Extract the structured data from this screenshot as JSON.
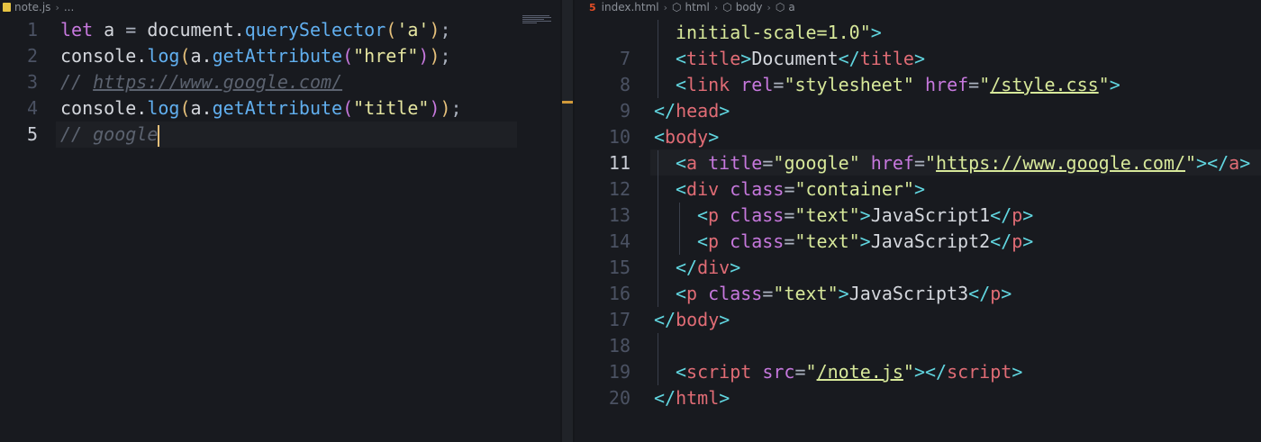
{
  "left_editor": {
    "breadcrumb": {
      "file": "note.js",
      "more": "..."
    },
    "lines": [
      {
        "num": "1",
        "tokens": [
          [
            "kw",
            "let"
          ],
          [
            "ident",
            " a "
          ],
          [
            "pun",
            "= "
          ],
          [
            "ident",
            "document."
          ],
          [
            "fn",
            "querySelector"
          ],
          [
            "paren",
            "("
          ],
          [
            "sq",
            "'a'"
          ],
          [
            "paren",
            ")"
          ],
          [
            "pun",
            ";"
          ]
        ]
      },
      {
        "num": "2",
        "tokens": [
          [
            "ident",
            "console."
          ],
          [
            "fn",
            "log"
          ],
          [
            "paren",
            "("
          ],
          [
            "ident",
            "a."
          ],
          [
            "fn",
            "getAttribute"
          ],
          [
            "paren2",
            "("
          ],
          [
            "str",
            "\"href\""
          ],
          [
            "paren2",
            ")"
          ],
          [
            "paren",
            ")"
          ],
          [
            "pun",
            ";"
          ]
        ]
      },
      {
        "num": "3",
        "tokens": [
          [
            "cmt",
            "// "
          ],
          [
            "cmt-u",
            "https://www.google.com/"
          ]
        ]
      },
      {
        "num": "4",
        "tokens": [
          [
            "ident",
            "console."
          ],
          [
            "fn",
            "log"
          ],
          [
            "paren",
            "("
          ],
          [
            "ident",
            "a."
          ],
          [
            "fn",
            "getAttribute"
          ],
          [
            "paren2",
            "("
          ],
          [
            "str",
            "\"title\""
          ],
          [
            "paren2",
            ")"
          ],
          [
            "paren",
            ")"
          ],
          [
            "pun",
            ";"
          ]
        ]
      },
      {
        "num": "5",
        "tokens": [
          [
            "cmt",
            "// google"
          ]
        ],
        "active": true,
        "cursor": true
      }
    ]
  },
  "right_editor": {
    "breadcrumb": {
      "file": "index.html",
      "items": [
        "html",
        "body",
        "a"
      ]
    },
    "lines": [
      {
        "num": "",
        "indent": 1,
        "tokens": [
          [
            "aval",
            "initial-scale=1.0\""
          ],
          [
            "brk",
            ">"
          ]
        ]
      },
      {
        "num": "7",
        "indent": 1,
        "tokens": [
          [
            "brk",
            "<"
          ],
          [
            "tag",
            "title"
          ],
          [
            "brk",
            ">"
          ],
          [
            "txt",
            "Document"
          ],
          [
            "brk",
            "</"
          ],
          [
            "tag",
            "title"
          ],
          [
            "brk",
            ">"
          ]
        ]
      },
      {
        "num": "8",
        "indent": 1,
        "tokens": [
          [
            "brk",
            "<"
          ],
          [
            "tag",
            "link "
          ],
          [
            "attr",
            "rel"
          ],
          [
            "pun",
            "="
          ],
          [
            "aval",
            "\"stylesheet\" "
          ],
          [
            "attr",
            "href"
          ],
          [
            "pun",
            "="
          ],
          [
            "aval",
            "\""
          ],
          [
            "url",
            "/style.css"
          ],
          [
            "aval",
            "\""
          ],
          [
            "brk",
            ">"
          ]
        ]
      },
      {
        "num": "9",
        "indent": 0,
        "tokens": [
          [
            "brk",
            "</"
          ],
          [
            "tag",
            "head"
          ],
          [
            "brk",
            ">"
          ]
        ]
      },
      {
        "num": "10",
        "indent": 0,
        "tokens": [
          [
            "brk",
            "<"
          ],
          [
            "tag",
            "body"
          ],
          [
            "brk",
            ">"
          ]
        ]
      },
      {
        "num": "11",
        "indent": 1,
        "active": true,
        "tokens": [
          [
            "brk",
            "<"
          ],
          [
            "tag",
            "a "
          ],
          [
            "attr",
            "title"
          ],
          [
            "pun",
            "="
          ],
          [
            "aval",
            "\"google\" "
          ],
          [
            "attr",
            "href"
          ],
          [
            "pun",
            "="
          ],
          [
            "aval",
            "\""
          ],
          [
            "url",
            "https://www.google.com/"
          ],
          [
            "aval",
            "\""
          ],
          [
            "brk",
            "></"
          ],
          [
            "tag",
            "a"
          ],
          [
            "brk",
            ">"
          ]
        ]
      },
      {
        "num": "12",
        "indent": 1,
        "tokens": [
          [
            "brk",
            "<"
          ],
          [
            "tag",
            "div "
          ],
          [
            "attr",
            "class"
          ],
          [
            "pun",
            "="
          ],
          [
            "aval",
            "\"container\""
          ],
          [
            "brk",
            ">"
          ]
        ]
      },
      {
        "num": "13",
        "indent": 2,
        "tokens": [
          [
            "brk",
            "<"
          ],
          [
            "tag",
            "p "
          ],
          [
            "attr",
            "class"
          ],
          [
            "pun",
            "="
          ],
          [
            "aval",
            "\"text\""
          ],
          [
            "brk",
            ">"
          ],
          [
            "txt",
            "JavaScript1"
          ],
          [
            "brk",
            "</"
          ],
          [
            "tag",
            "p"
          ],
          [
            "brk",
            ">"
          ]
        ]
      },
      {
        "num": "14",
        "indent": 2,
        "tokens": [
          [
            "brk",
            "<"
          ],
          [
            "tag",
            "p "
          ],
          [
            "attr",
            "class"
          ],
          [
            "pun",
            "="
          ],
          [
            "aval",
            "\"text\""
          ],
          [
            "brk",
            ">"
          ],
          [
            "txt",
            "JavaScript2"
          ],
          [
            "brk",
            "</"
          ],
          [
            "tag",
            "p"
          ],
          [
            "brk",
            ">"
          ]
        ]
      },
      {
        "num": "15",
        "indent": 1,
        "tokens": [
          [
            "brk",
            "</"
          ],
          [
            "tag",
            "div"
          ],
          [
            "brk",
            ">"
          ]
        ]
      },
      {
        "num": "16",
        "indent": 1,
        "tokens": [
          [
            "brk",
            "<"
          ],
          [
            "tag",
            "p "
          ],
          [
            "attr",
            "class"
          ],
          [
            "pun",
            "="
          ],
          [
            "aval",
            "\"text\""
          ],
          [
            "brk",
            ">"
          ],
          [
            "txt",
            "JavaScript3"
          ],
          [
            "brk",
            "</"
          ],
          [
            "tag",
            "p"
          ],
          [
            "brk",
            ">"
          ]
        ]
      },
      {
        "num": "17",
        "indent": 0,
        "tokens": [
          [
            "brk",
            "</"
          ],
          [
            "tag",
            "body"
          ],
          [
            "brk",
            ">"
          ]
        ]
      },
      {
        "num": "18",
        "indent": 0,
        "tokens": []
      },
      {
        "num": "19",
        "indent": 1,
        "tokens": [
          [
            "brk",
            "<"
          ],
          [
            "tag",
            "script "
          ],
          [
            "attr",
            "src"
          ],
          [
            "pun",
            "="
          ],
          [
            "aval",
            "\""
          ],
          [
            "url",
            "/note.js"
          ],
          [
            "aval",
            "\""
          ],
          [
            "brk",
            "></"
          ],
          [
            "tag",
            "script"
          ],
          [
            "brk",
            ">"
          ]
        ]
      },
      {
        "num": "20",
        "indent": 0,
        "tokens": [
          [
            "brk",
            "</"
          ],
          [
            "tag",
            "html"
          ],
          [
            "brk",
            ">"
          ]
        ]
      }
    ]
  }
}
